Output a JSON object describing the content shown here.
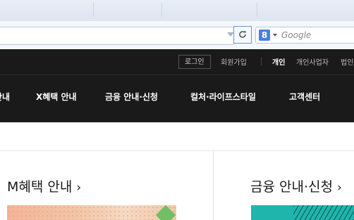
{
  "browser": {
    "search": {
      "engine_glyph": "8",
      "placeholder": "Google"
    },
    "icons": [
      "reload-icon",
      "url-dropmarker-icon",
      "search-engine-icon",
      "dropdown-arrow-icon"
    ],
    "accent": "#6f95c9"
  },
  "utility": {
    "login": "로그인",
    "signup": "회원가입",
    "personal": "개인",
    "business": "개인사업자",
    "corporate": "법인"
  },
  "nav": {
    "item0": "안내",
    "item1": "X혜택 안내",
    "item2": "금융 안내·신청",
    "item3": "컬처·라이프스타일",
    "item4": "고객센터"
  },
  "sections": {
    "m_benefits": {
      "title": "M혜택 안내",
      "chevron": "›"
    },
    "finance": {
      "title": "금융 안내·신청",
      "chevron": "›"
    }
  },
  "colors": {
    "header_bg": "#1a1a1a",
    "teal": "#1fb5ad",
    "peach": "#f3b49a"
  }
}
